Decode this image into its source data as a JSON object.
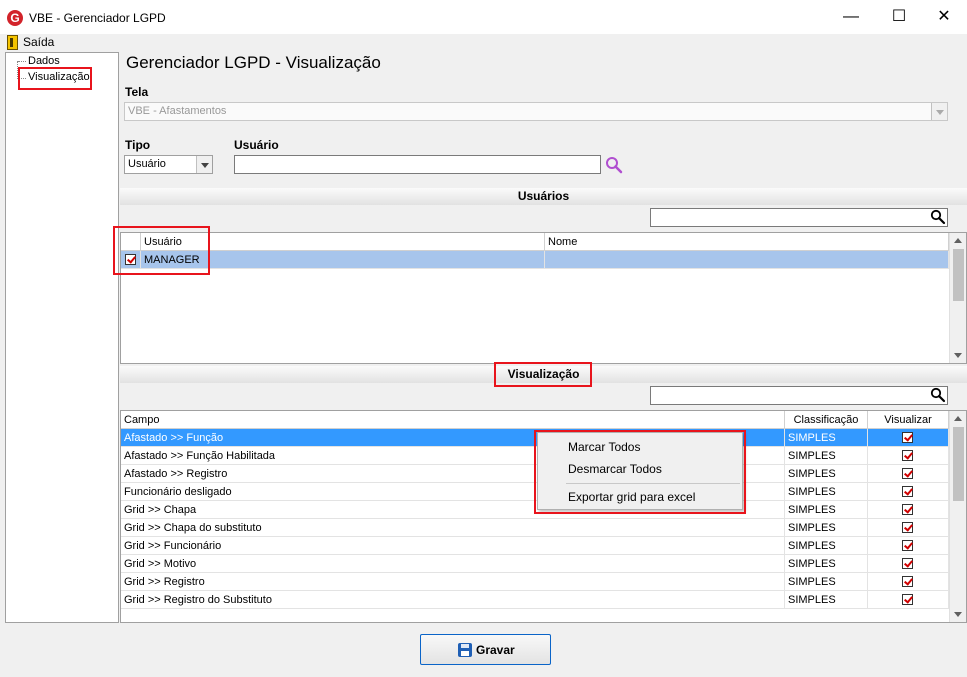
{
  "window": {
    "app_icon_letter": "G",
    "title": "VBE - Gerenciador LGPD",
    "minimize_glyph": "—",
    "maximize_glyph": "☐",
    "close_glyph": "✕"
  },
  "menu": {
    "exit_label": "Saída",
    "exit_icon": "door-exit-icon"
  },
  "tree": {
    "items": [
      {
        "label": "Dados"
      },
      {
        "label": "Visualização",
        "highlighted": true
      }
    ]
  },
  "page": {
    "title": "Gerenciador LGPD - Visualização"
  },
  "tela": {
    "label": "Tela",
    "value": "VBE - Afastamentos"
  },
  "tipo": {
    "label": "Tipo",
    "value": "Usuário"
  },
  "usuario_field": {
    "label": "Usuário",
    "value": ""
  },
  "usuarios_section": {
    "title": "Usuários",
    "search_value": "",
    "columns": [
      "Usuário",
      "Nome"
    ],
    "rows": [
      {
        "checked": true,
        "usuario": "MANAGER",
        "nome": ""
      }
    ]
  },
  "visualizacao_section": {
    "title": "Visualização",
    "search_value": "",
    "columns": [
      "Campo",
      "Classificação",
      "Visualizar"
    ],
    "rows": [
      {
        "campo": "Afastado >> Função",
        "classificacao": "SIMPLES",
        "visualizar": true
      },
      {
        "campo": "Afastado >> Função Habilitada",
        "classificacao": "SIMPLES",
        "visualizar": true
      },
      {
        "campo": "Afastado >> Registro",
        "classificacao": "SIMPLES",
        "visualizar": true
      },
      {
        "campo": "Funcionário desligado",
        "classificacao": "SIMPLES",
        "visualizar": true
      },
      {
        "campo": "Grid >> Chapa",
        "classificacao": "SIMPLES",
        "visualizar": true
      },
      {
        "campo": "Grid >> Chapa do substituto",
        "classificacao": "SIMPLES",
        "visualizar": true
      },
      {
        "campo": "Grid >> Funcionário",
        "classificacao": "SIMPLES",
        "visualizar": true
      },
      {
        "campo": "Grid >> Motivo",
        "classificacao": "SIMPLES",
        "visualizar": true
      },
      {
        "campo": "Grid >> Registro",
        "classificacao": "SIMPLES",
        "visualizar": true
      },
      {
        "campo": "Grid >> Registro do Substituto",
        "classificacao": "SIMPLES",
        "visualizar": true
      }
    ]
  },
  "context_menu": {
    "items": [
      "Marcar Todos",
      "Desmarcar Todos",
      "Exportar grid para excel"
    ]
  },
  "footer": {
    "save_label": "Gravar"
  },
  "colors": {
    "highlight_box": "#e8141c",
    "row_selected": "#3399ff",
    "row_selected_inactive": "#a7c5ec",
    "search_icon": "#b04fd0"
  }
}
